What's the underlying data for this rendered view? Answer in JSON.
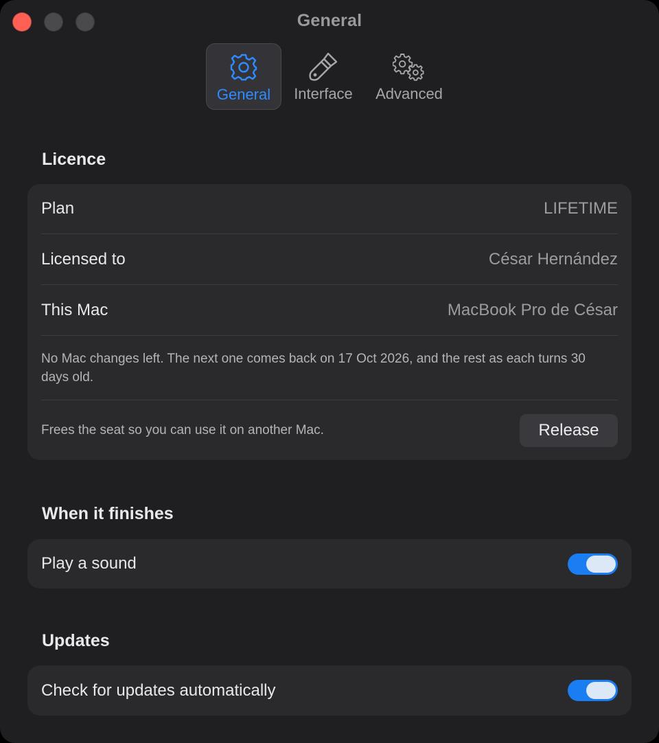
{
  "window": {
    "title": "General"
  },
  "tabs": [
    {
      "label": "General",
      "icon": "gear-icon",
      "active": true
    },
    {
      "label": "Interface",
      "icon": "paintbrush-icon",
      "active": false
    },
    {
      "label": "Advanced",
      "icon": "gears-icon",
      "active": false
    }
  ],
  "licence": {
    "title": "Licence",
    "rows": [
      {
        "label": "Plan",
        "value": "LIFETIME"
      },
      {
        "label": "Licensed to",
        "value": "César Hernández"
      },
      {
        "label": "This Mac",
        "value": "MacBook Pro de César"
      }
    ],
    "note": "No Mac changes left. The next one comes back on 17 Oct 2026, and the rest as each turns 30 days old.",
    "release_hint": "Frees the seat so you can use it on another Mac.",
    "release_label": "Release"
  },
  "finish": {
    "title": "When it finishes",
    "play_sound_label": "Play a sound",
    "play_sound_on": true
  },
  "updates": {
    "title": "Updates",
    "auto_check_label": "Check for updates automatically",
    "auto_check_on": true
  },
  "colors": {
    "accent": "#2d8cff",
    "toggle_on": "#1b7df2",
    "window_bg": "#1f1f21",
    "card_bg": "#2a2a2d"
  }
}
